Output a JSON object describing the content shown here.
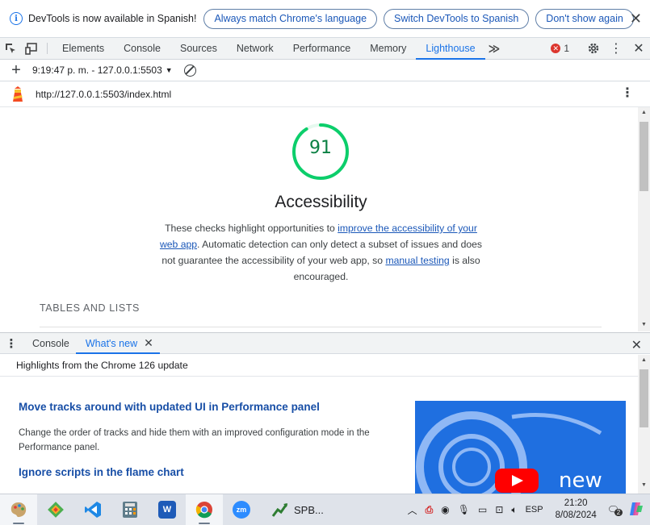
{
  "infobar": {
    "text": "DevTools is now available in Spanish!",
    "btn_match": "Always match Chrome's language",
    "btn_switch": "Switch DevTools to Spanish",
    "btn_dismiss": "Don't show again"
  },
  "tabs": {
    "items": [
      "Elements",
      "Console",
      "Sources",
      "Network",
      "Performance",
      "Memory",
      "Lighthouse"
    ],
    "active": "Lighthouse",
    "error_count": "1"
  },
  "lighthouse": {
    "report_selector": "9:19:47 p. m. - 127.0.0.1:5503",
    "url": "http://127.0.0.1:5503/index.html"
  },
  "report": {
    "score": 91,
    "score_display": "91",
    "score_color": "#0cce6b",
    "category_title": "Accessibility",
    "desc_1": "These checks highlight opportunities to ",
    "desc_link_1": "improve the accessibility of your web app",
    "desc_2": ". Automatic detection can only detect a subset of issues and does not guarantee the accessibility of your web app, so ",
    "desc_link_2": "manual testing",
    "desc_3": " is also encouraged.",
    "group_title": "TABLES AND LISTS"
  },
  "drawer": {
    "tab_console": "Console",
    "tab_whatsnew": "What's new",
    "header": "Highlights from the Chrome 126 update",
    "h1": "Move tracks around with updated UI in Performance panel",
    "p1": "Change the order of tracks and hide them with an improved configuration mode in the Performance panel.",
    "h2": "Ignore scripts in the flame chart",
    "thumb_text": "new"
  },
  "taskbar": {
    "spb_label": "SPB...",
    "lang": "ESP",
    "time": "21:20",
    "date": "8/08/2024",
    "notif_count": "2"
  },
  "colors": {
    "accent": "#1a73e8",
    "error": "#dc362e",
    "score_good": "#0cce6b"
  }
}
